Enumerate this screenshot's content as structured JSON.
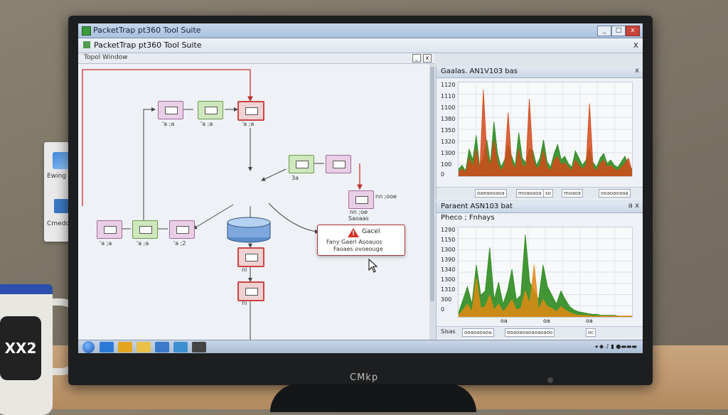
{
  "environment": {
    "mug_text": "XX2",
    "monitor_brand": "CMkp",
    "desktop_icons": [
      {
        "label": "Ewing",
        "icon": "desktop-app-icon"
      },
      {
        "label": "Cmedo",
        "icon": "desktop-folder-icon"
      }
    ]
  },
  "window": {
    "outer_title": "PacketTrap pt360 Tool Suite",
    "inner_title": "PacketTrap pt360 Tool Suite",
    "controls": {
      "minimize": "_",
      "maximize": "□",
      "close": "x"
    }
  },
  "topology": {
    "header": "Topol Window",
    "header_controls": {
      "minimize": "_",
      "close": "x"
    },
    "nodes_row1": [
      {
        "label": "'a ;a"
      },
      {
        "label": "'a ;a"
      },
      {
        "label": "'a ;a"
      }
    ],
    "nodes_mid": [
      {
        "label": "3a"
      },
      {
        "label": ""
      },
      {
        "label": "nn ;ooe"
      }
    ],
    "nodes_row3": [
      {
        "label": "'a ;a"
      },
      {
        "label": "'a ;a"
      },
      {
        "label": "'a ;2"
      }
    ],
    "right_node_label": "nn ;oe\nSaoaas",
    "vertical_nodes": [
      {
        "label": "ni"
      },
      {
        "label": "ni"
      }
    ],
    "alert": {
      "title": "Gacel",
      "line1": "Fany Gaerl Asoauos",
      "line2": "Faoaes ovoeouge"
    }
  },
  "panel_top": {
    "title": "Gaalas. AN1V103 bas",
    "controls": "x",
    "y_ticks": [
      "1120",
      "1110",
      "1100",
      "1380",
      "1350",
      "1320",
      "1300",
      "100",
      "0"
    ],
    "footer_chips": [
      "oaeaooaoa",
      "moaoaoa",
      "so",
      "moaoa",
      "ooaoaoaaa"
    ]
  },
  "panel_bottom": {
    "title": "Paraent ASN103 bat",
    "subtitle": "Pheco ; Fnhays",
    "controls": "a x",
    "y_ticks": [
      "1290",
      "1150",
      "1300",
      "1390",
      "1340",
      "1300",
      "1310",
      "300",
      "0"
    ],
    "x_ticks": [
      "oa",
      "oa",
      "oa"
    ],
    "footer_left": "Sisas",
    "footer_chips": [
      "ooaoaoaoa",
      "ooaoaoaoaoaoaoo",
      "oc"
    ]
  },
  "chart_data": [
    {
      "type": "area",
      "title": "Gaalas. AN1V103 bas",
      "y_ticks": [
        "1120",
        "1110",
        "1100",
        "1380",
        "1350",
        "1320",
        "1300",
        "100",
        "0"
      ],
      "series": [
        {
          "color": "#2e8b1f",
          "values": [
            8,
            12,
            6,
            30,
            18,
            45,
            9,
            22,
            40,
            14,
            60,
            25,
            10,
            18,
            35,
            22,
            12,
            48,
            20,
            15,
            30,
            28,
            12,
            20,
            40,
            16,
            10,
            25,
            35,
            18,
            22,
            14,
            10,
            28,
            20,
            12,
            18,
            30,
            15,
            10,
            20,
            25,
            14,
            18,
            12,
            10,
            16,
            22,
            12,
            8
          ]
        },
        {
          "color": "#d24a1a",
          "values": [
            5,
            8,
            4,
            20,
            10,
            30,
            6,
            95,
            25,
            10,
            40,
            15,
            6,
            12,
            70,
            15,
            8,
            30,
            12,
            10,
            85,
            20,
            8,
            12,
            28,
            10,
            6,
            18,
            22,
            12,
            15,
            10,
            6,
            18,
            12,
            8,
            12,
            80,
            10,
            6,
            14,
            18,
            10,
            12,
            8,
            6,
            10,
            14,
            20,
            6
          ]
        }
      ]
    },
    {
      "type": "area",
      "title": "Paraent ASN103 bat",
      "subtitle": "Pheco ; Fnhays",
      "y_ticks": [
        "1290",
        "1150",
        "1300",
        "1390",
        "1340",
        "1300",
        "1310",
        "300",
        "0"
      ],
      "x_ticks": [
        "oa",
        "oa",
        "oa"
      ],
      "series": [
        {
          "color": "#2e8b1f",
          "values": [
            5,
            20,
            35,
            15,
            60,
            25,
            30,
            80,
            20,
            40,
            15,
            30,
            55,
            20,
            25,
            95,
            40,
            30,
            20,
            60,
            35,
            25,
            15,
            30,
            20,
            12,
            8,
            6,
            5,
            4,
            3,
            3,
            2,
            2,
            2,
            2,
            1,
            1,
            1,
            1
          ]
        },
        {
          "color": "#e08a12",
          "values": [
            2,
            8,
            15,
            6,
            45,
            10,
            12,
            25,
            8,
            15,
            6,
            12,
            20,
            8,
            10,
            30,
            15,
            60,
            8,
            20,
            12,
            10,
            6,
            12,
            8,
            5,
            3,
            2,
            2,
            2,
            1,
            1,
            1,
            1,
            1,
            1,
            1,
            1,
            1,
            1
          ]
        }
      ]
    }
  ],
  "taskbar": {
    "apps": [
      {
        "icon": "ie-icon",
        "color": "#2d7ad6"
      },
      {
        "icon": "chrome-icon",
        "color": "#e5a51e"
      },
      {
        "icon": "folder-icon",
        "color": "#e8c04a"
      },
      {
        "icon": "explorer-icon",
        "color": "#3a7ac8"
      },
      {
        "icon": "media-icon",
        "color": "#3f8fd3"
      },
      {
        "icon": "packettrap-icon",
        "color": "#444"
      }
    ],
    "tray": "◂ ◆ ♪ ▮ ●▬▬▬"
  }
}
